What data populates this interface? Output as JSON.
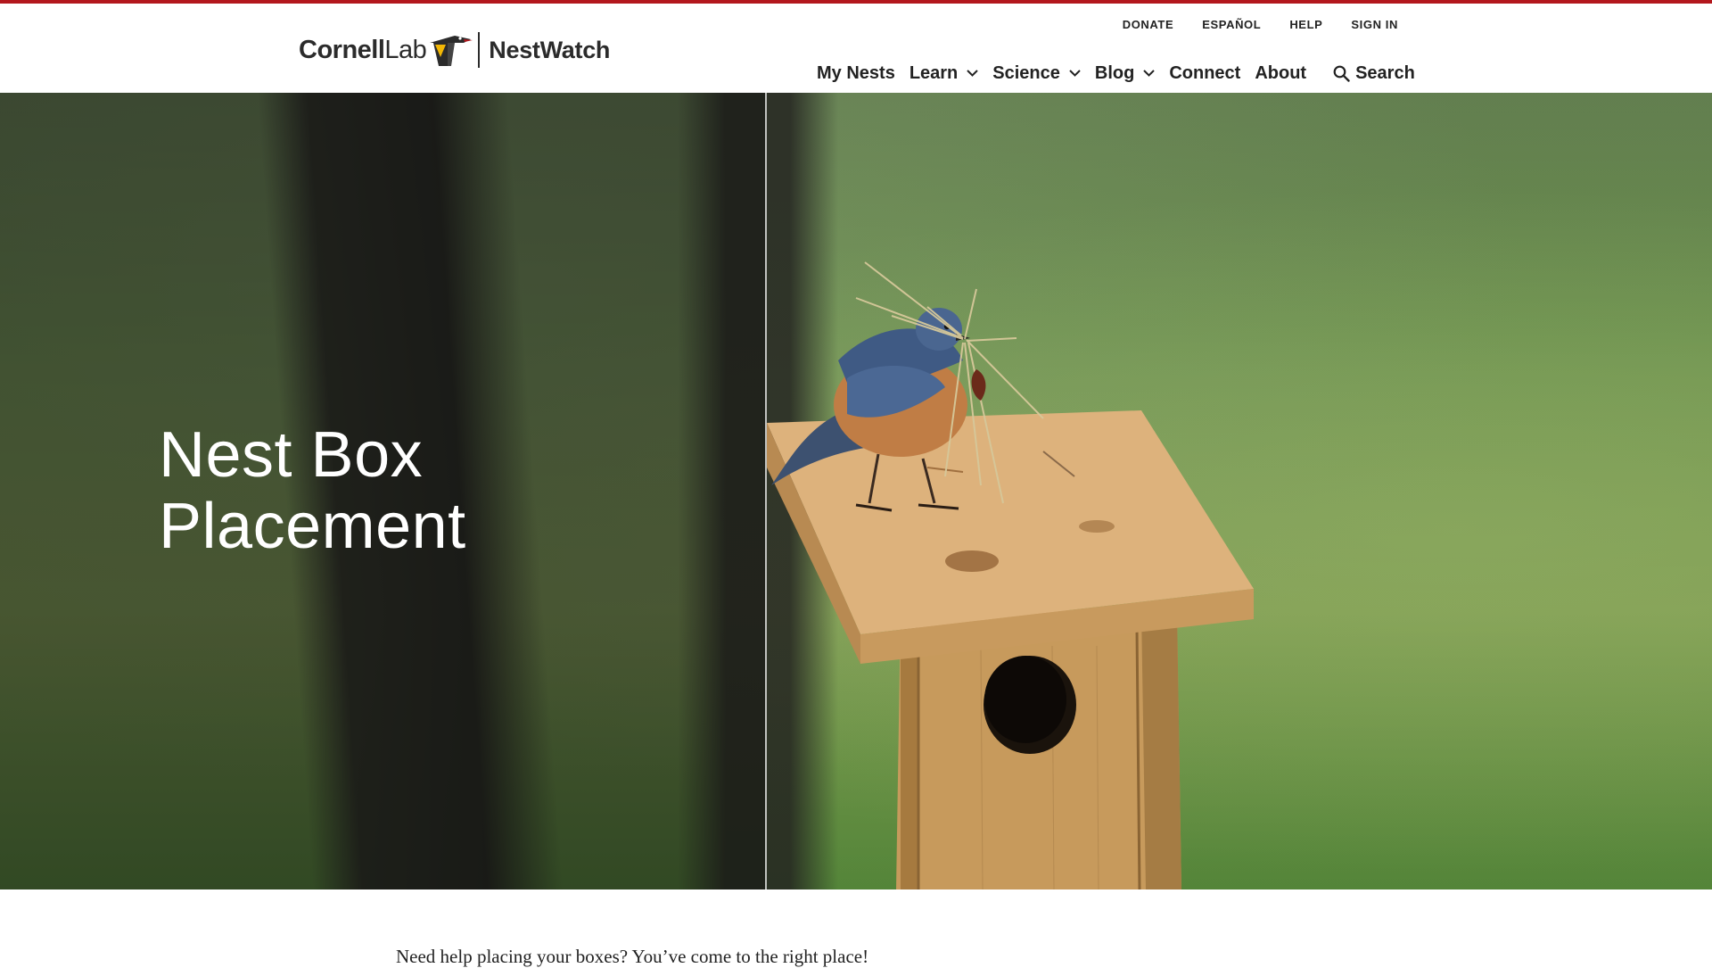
{
  "header": {
    "logo": {
      "brand": "Cornell",
      "lab": "Lab",
      "site": "NestWatch"
    },
    "utility_links": [
      "DONATE",
      "ESPAÑOL",
      "HELP",
      "SIGN IN"
    ],
    "nav": [
      {
        "label": "My Nests",
        "dropdown": false,
        "active": false
      },
      {
        "label": "Learn",
        "dropdown": true,
        "active": true
      },
      {
        "label": "Science",
        "dropdown": true,
        "active": false
      },
      {
        "label": "Blog",
        "dropdown": true,
        "active": false
      },
      {
        "label": "Connect",
        "dropdown": false,
        "active": false
      },
      {
        "label": "About",
        "dropdown": false,
        "active": false
      }
    ],
    "search_label": "Search",
    "search_icon": "magnifier-icon"
  },
  "hero": {
    "title_line1": "Nest Box",
    "title_line2": "Placement",
    "image_subject": "bluebird-on-nest-box-image"
  },
  "intro_text": "Need help placing your boxes? You’ve come to the right place!",
  "colors": {
    "top_accent": "#b3171d",
    "nav_active_underline": "#1f8a4c",
    "text": "#222222",
    "hero_text": "#ffffff"
  }
}
